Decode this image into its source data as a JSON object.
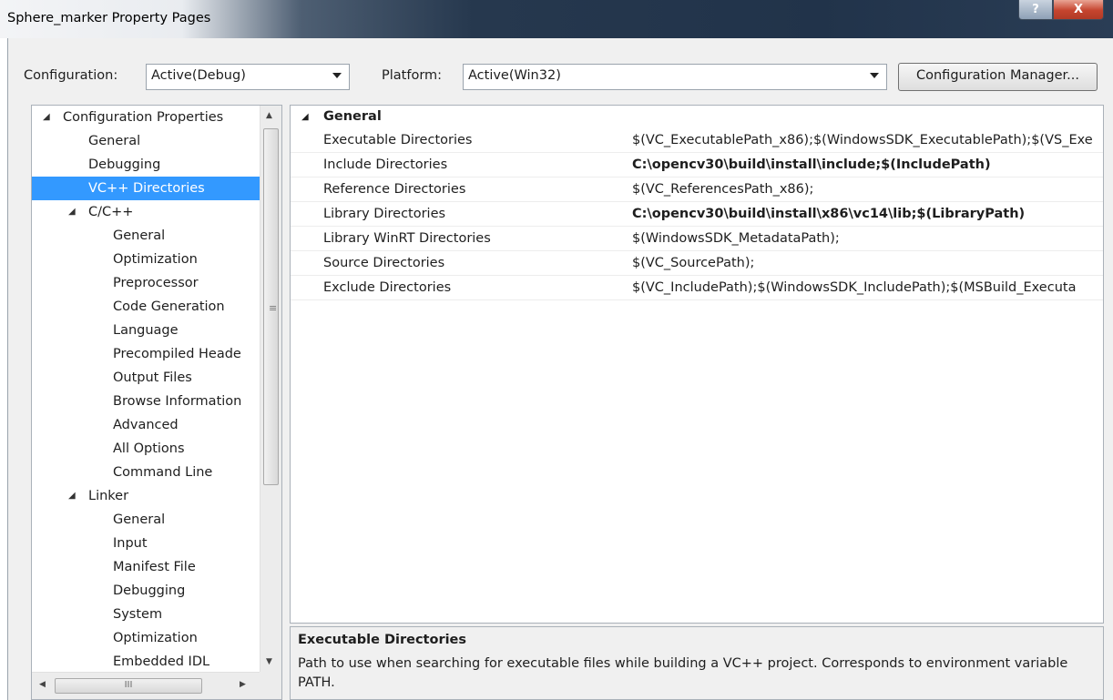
{
  "window": {
    "title": "Sphere_marker Property Pages",
    "help_label": "?",
    "close_label": "X"
  },
  "configbar": {
    "configuration_label": "Configuration:",
    "configuration_value": "Active(Debug)",
    "platform_label": "Platform:",
    "platform_value": "Active(Win32)",
    "config_manager_label": "Configuration Manager..."
  },
  "tree": {
    "items": [
      {
        "label": "Configuration Properties",
        "level": 0,
        "expanded": true,
        "selected": false
      },
      {
        "label": "General",
        "level": 1,
        "selected": false
      },
      {
        "label": "Debugging",
        "level": 1,
        "selected": false
      },
      {
        "label": "VC++ Directories",
        "level": 1,
        "selected": true
      },
      {
        "label": "C/C++",
        "level": 1,
        "expanded": true,
        "selected": false
      },
      {
        "label": "General",
        "level": 2,
        "selected": false
      },
      {
        "label": "Optimization",
        "level": 2,
        "selected": false
      },
      {
        "label": "Preprocessor",
        "level": 2,
        "selected": false
      },
      {
        "label": "Code Generation",
        "level": 2,
        "selected": false
      },
      {
        "label": "Language",
        "level": 2,
        "selected": false
      },
      {
        "label": "Precompiled Heade",
        "level": 2,
        "selected": false
      },
      {
        "label": "Output Files",
        "level": 2,
        "selected": false
      },
      {
        "label": "Browse Information",
        "level": 2,
        "selected": false
      },
      {
        "label": "Advanced",
        "level": 2,
        "selected": false
      },
      {
        "label": "All Options",
        "level": 2,
        "selected": false
      },
      {
        "label": "Command Line",
        "level": 2,
        "selected": false
      },
      {
        "label": "Linker",
        "level": 1,
        "expanded": true,
        "selected": false
      },
      {
        "label": "General",
        "level": 2,
        "selected": false
      },
      {
        "label": "Input",
        "level": 2,
        "selected": false
      },
      {
        "label": "Manifest File",
        "level": 2,
        "selected": false
      },
      {
        "label": "Debugging",
        "level": 2,
        "selected": false
      },
      {
        "label": "System",
        "level": 2,
        "selected": false
      },
      {
        "label": "Optimization",
        "level": 2,
        "selected": false
      },
      {
        "label": "Embedded IDL",
        "level": 2,
        "selected": false
      }
    ],
    "scroll_grip": "≡",
    "hscroll_grip": "III"
  },
  "grid": {
    "section": "General",
    "rows": [
      {
        "name": "Executable Directories",
        "value": "$(VC_ExecutablePath_x86);$(WindowsSDK_ExecutablePath);$(VS_Exe",
        "bold": false
      },
      {
        "name": "Include Directories",
        "value": "C:\\opencv30\\build\\install\\include;$(IncludePath)",
        "bold": true
      },
      {
        "name": "Reference Directories",
        "value": "$(VC_ReferencesPath_x86);",
        "bold": false
      },
      {
        "name": "Library Directories",
        "value": "C:\\opencv30\\build\\install\\x86\\vc14\\lib;$(LibraryPath)",
        "bold": true
      },
      {
        "name": "Library WinRT Directories",
        "value": "$(WindowsSDK_MetadataPath);",
        "bold": false
      },
      {
        "name": "Source Directories",
        "value": "$(VC_SourcePath);",
        "bold": false
      },
      {
        "name": "Exclude Directories",
        "value": "$(VC_IncludePath);$(WindowsSDK_IncludePath);$(MSBuild_Executa",
        "bold": false
      }
    ]
  },
  "description": {
    "title": "Executable Directories",
    "text": "Path to use when searching for executable files while building a VC++ project.  Corresponds to environment variable PATH."
  },
  "colors": {
    "selection": "#3399ff",
    "titlebar_dark": "#21334a",
    "dialog_bg": "#f0f0f0"
  }
}
